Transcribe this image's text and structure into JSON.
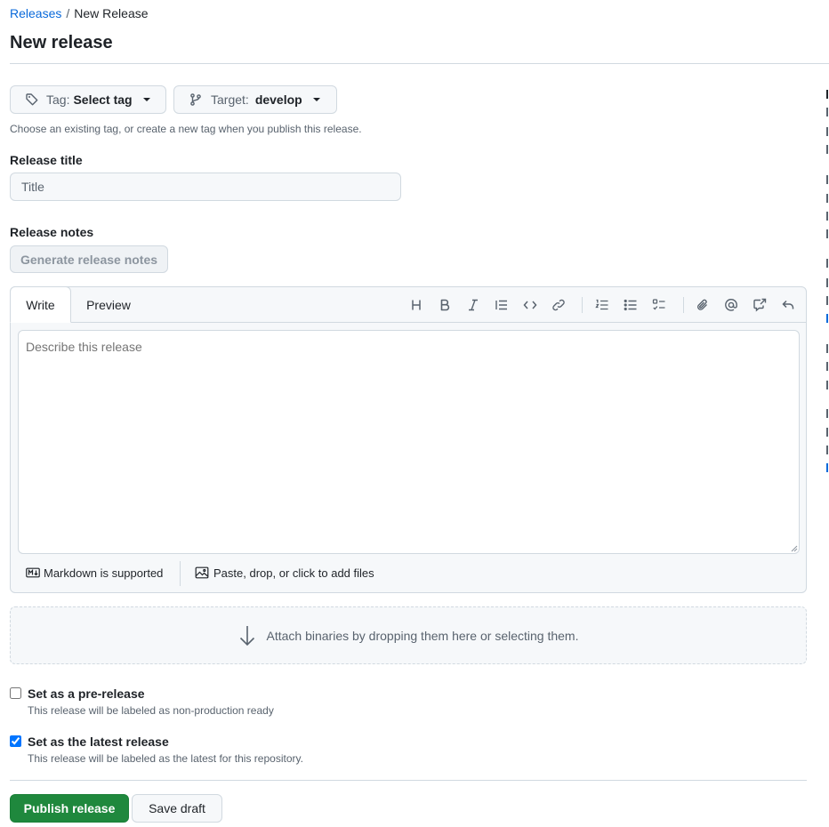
{
  "breadcrumb": {
    "root": "Releases",
    "separator": "/",
    "current": "New Release"
  },
  "page_title": "New release",
  "tag_button": {
    "prefix": "Tag:",
    "value": "Select tag"
  },
  "target_button": {
    "prefix": "Target:",
    "value": "develop"
  },
  "tag_hint": "Choose an existing tag, or create a new tag when you publish this release.",
  "release_title": {
    "label": "Release title",
    "placeholder": "Title",
    "value": ""
  },
  "release_notes": {
    "label": "Release notes",
    "generate_button": "Generate release notes",
    "tabs": [
      "Write",
      "Preview"
    ],
    "active_tab": "Write",
    "toolbar_icons": [
      "heading-icon",
      "bold-icon",
      "italic-icon",
      "quote-icon",
      "code-icon",
      "link-icon",
      "ordered-list-icon",
      "unordered-list-icon",
      "task-list-icon",
      "attach-icon",
      "mention-icon",
      "cross-reference-icon",
      "reply-icon"
    ],
    "placeholder": "Describe this release",
    "markdown_note": "Markdown is supported",
    "files_note": "Paste, drop, or click to add files"
  },
  "attach_binaries": "Attach binaries by dropping them here or selecting them.",
  "prerelease": {
    "label": "Set as a pre-release",
    "description": "This release will be labeled as non-production ready",
    "checked": false
  },
  "latest": {
    "label": "Set as the latest release",
    "description": "This release will be labeled as the latest for this repository.",
    "checked": true
  },
  "actions": {
    "publish": "Publish release",
    "draft": "Save draft"
  },
  "colors": {
    "primary": "#1f883d",
    "link": "#0969da",
    "muted": "#59636e",
    "border": "#d1d9e0"
  }
}
